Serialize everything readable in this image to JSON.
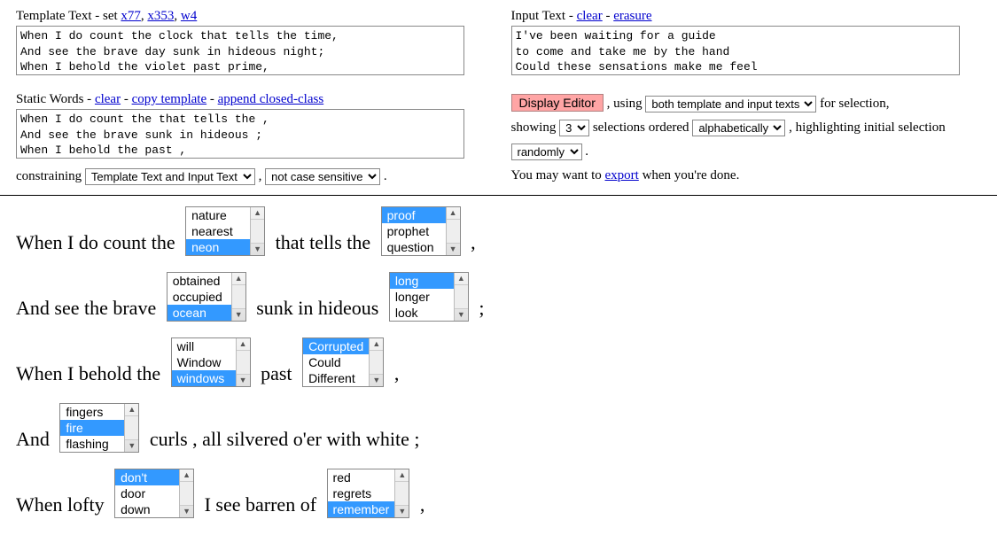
{
  "template": {
    "label": "Template Text - set ",
    "link1": "x77",
    "link2": "x353",
    "link3": "w4",
    "text": "When I do count the clock that tells the time,\nAnd see the brave day sunk in hideous night;\nWhen I behold the violet past prime,"
  },
  "input": {
    "label": "Input Text - ",
    "link1": "clear",
    "link2": "erasure",
    "text": "I've been waiting for a guide\nto come and take me by the hand\nCould these sensations make me feel"
  },
  "static": {
    "label": "Static Words - ",
    "link1": "clear",
    "link2": "copy template",
    "link3": "append closed-class",
    "text": "When I do count the that tells the ,\nAnd see the brave sunk in hideous ;\nWhen I behold the past ,"
  },
  "constrain": {
    "prefix": "constraining",
    "opt1": "Template Text and Input Text",
    "opt2": "not case sensitive",
    "suffix": "."
  },
  "controls": {
    "displayEditor": "Display Editor",
    "using": ", using",
    "usingOpt": "both template and input texts",
    "forSelection": "for selection,",
    "showing": "showing",
    "showingOpt": "3",
    "selectionsOrdered": "selections ordered",
    "orderedOpt": "alphabetically",
    "highlighting": ", highlighting initial selection",
    "highlightOpt": "randomly",
    "dot": ".",
    "youMay": "You may want to ",
    "exportLink": "export",
    "whenDone": " when you're done."
  },
  "poem": [
    {
      "parts": [
        {
          "t": "When I do count the "
        },
        {
          "picker": {
            "opts": [
              "nature",
              "nearest",
              "neon"
            ],
            "sel": 2
          }
        },
        {
          "t": " that tells the "
        },
        {
          "picker": {
            "opts": [
              "proof",
              "prophet",
              "question"
            ],
            "sel": 0
          }
        },
        {
          "t": " ,"
        }
      ]
    },
    {
      "parts": [
        {
          "t": "And see the brave "
        },
        {
          "picker": {
            "opts": [
              "obtained",
              "occupied",
              "ocean"
            ],
            "sel": 2
          }
        },
        {
          "t": " sunk in hideous "
        },
        {
          "picker": {
            "opts": [
              "long",
              "longer",
              "look"
            ],
            "sel": 0
          }
        },
        {
          "t": " ;"
        }
      ]
    },
    {
      "parts": [
        {
          "t": "When I behold the "
        },
        {
          "picker": {
            "opts": [
              "will",
              "Window",
              "windows"
            ],
            "sel": 2
          }
        },
        {
          "t": " past "
        },
        {
          "picker": {
            "opts": [
              "Corrupted",
              "Could",
              "Different"
            ],
            "sel": 0
          }
        },
        {
          "t": " ,"
        }
      ]
    },
    {
      "parts": [
        {
          "t": "And "
        },
        {
          "picker": {
            "opts": [
              "fingers",
              "fire",
              "flashing"
            ],
            "sel": 1
          }
        },
        {
          "t": " curls , all silvered o'er with white ;"
        }
      ]
    },
    {
      "parts": [
        {
          "t": "When lofty "
        },
        {
          "picker": {
            "opts": [
              "don't",
              "door",
              "down"
            ],
            "sel": 0
          }
        },
        {
          "t": " I see barren of "
        },
        {
          "picker": {
            "opts": [
              "red",
              "regrets",
              "remember"
            ],
            "sel": 2
          }
        },
        {
          "t": " ,"
        }
      ]
    }
  ]
}
